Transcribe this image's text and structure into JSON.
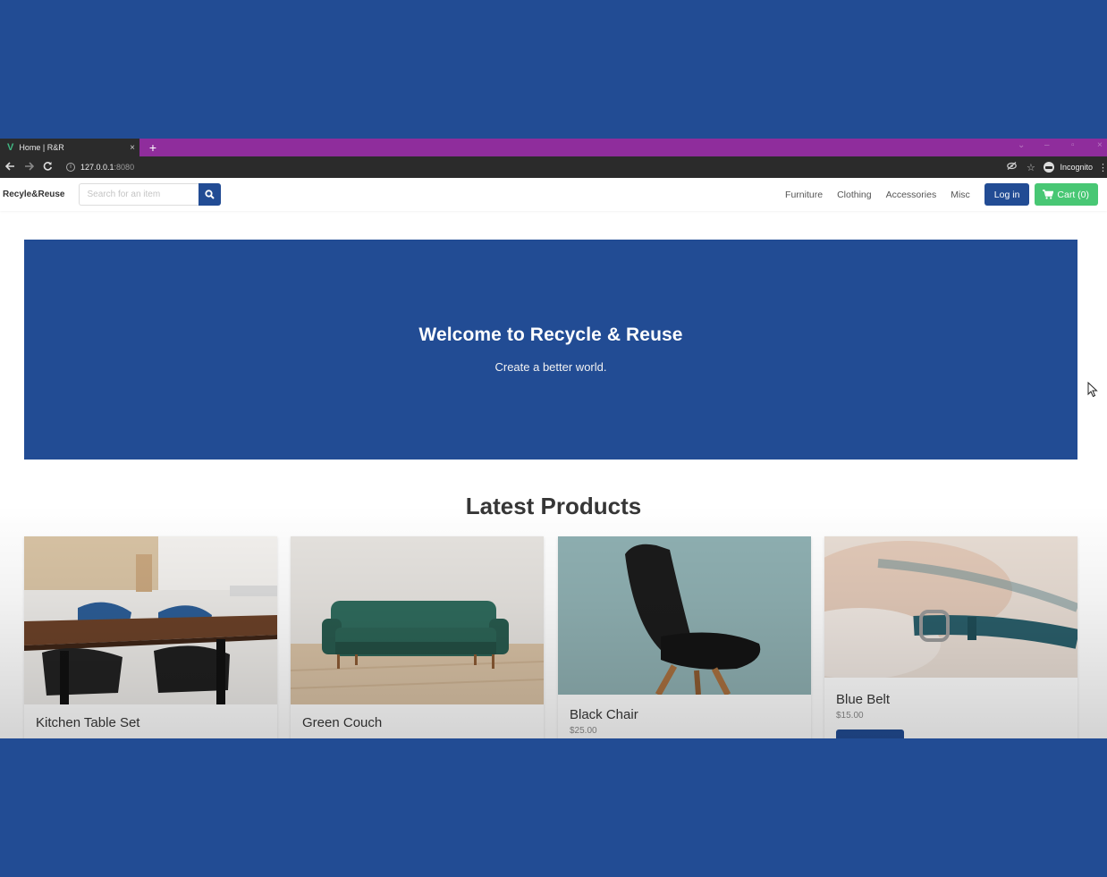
{
  "browser": {
    "tab_title": "Home | R&R",
    "tab_close": "×",
    "new_tab": "+",
    "url_host": "127.0.0.1",
    "url_port": ":8080",
    "profile_label": "Incognito",
    "accent_color": "#8f2d9c"
  },
  "site": {
    "brand": "Recyle&Reuse",
    "search_placeholder": "Search for an item",
    "nav": {
      "furniture": "Furniture",
      "clothing": "Clothing",
      "accessories": "Accessories",
      "misc": "Misc"
    },
    "login_label": "Log in",
    "cart_label": "Cart (0)",
    "primary_color": "#224c94",
    "cart_color": "#48c774"
  },
  "hero": {
    "title": "Welcome to Recycle & Reuse",
    "subtitle": "Create a better world."
  },
  "products_section": {
    "title": "Latest Products",
    "items": [
      {
        "name": "Kitchen Table Set",
        "price": ""
      },
      {
        "name": "Green Couch",
        "price": ""
      },
      {
        "name": "Black Chair",
        "price": "$25.00"
      },
      {
        "name": "Blue Belt",
        "price": "$15.00"
      }
    ]
  }
}
